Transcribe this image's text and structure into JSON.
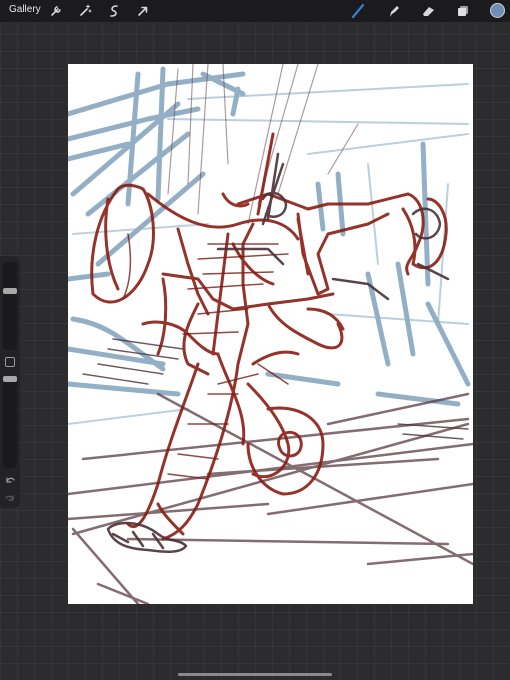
{
  "topbar": {
    "gallery_label": "Gallery",
    "left_tools": [
      "wrench-icon",
      "magic-wand-icon",
      "selection-icon",
      "transform-arrow-icon"
    ],
    "right_tools": [
      "brush-icon",
      "smudge-icon",
      "eraser-icon",
      "layers-icon"
    ],
    "active_tool": "brush-icon",
    "active_tool_color": "#3a7bd5",
    "current_color": "#6d8fb5"
  },
  "sidebar": {
    "brush_size_level": 0.2,
    "opacity_level": 0.3,
    "buttons": [
      "modify-square-icon",
      "undo-icon",
      "redo-icon"
    ]
  },
  "canvas": {
    "background": "#ffffff",
    "stroke_colors": {
      "blue_sketch": "#6e95b4",
      "red_sketch": "#8a1c12",
      "dark_sketch": "#4a3036"
    }
  }
}
